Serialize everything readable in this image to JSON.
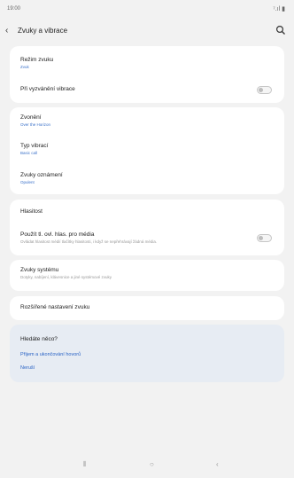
{
  "status": {
    "time": "19:00",
    "icons": "⁷.ıl ▮"
  },
  "appbar": {
    "title": "Zvuky a vibrace"
  },
  "card1": {
    "rezim_title": "Režim zvuku",
    "rezim_value": "Zvuk",
    "vibrate_title": "Při vyzvánění vibrace"
  },
  "card2": {
    "ringtone_title": "Zvonění",
    "ringtone_value": "Over the Horizon",
    "vibration_title": "Typ vibrací",
    "vibration_value": "Basic call",
    "notif_title": "Zvuky oznámení",
    "notif_value": "Opulent"
  },
  "card3": {
    "volume_title": "Hlasitost",
    "media_title": "Použít tl. ovl. hlas. pro média",
    "media_desc": "Ovládat hlasitost médií tlačítky hlasitosti, i když se nepřehrávají žádná média."
  },
  "card4": {
    "system_title": "Zvuky systému",
    "system_desc": "Dotyky, nabíjení, klávesnice a jiné systémové zvuky"
  },
  "card5": {
    "advanced_title": "Rozšířené nastavení zvuku"
  },
  "help": {
    "heading": "Hledáte něco?",
    "link1": "Přijem a ukončování hovorů",
    "link2": "Neruší"
  },
  "nav": {
    "recents": "⦀",
    "home": "○",
    "back": "‹"
  }
}
